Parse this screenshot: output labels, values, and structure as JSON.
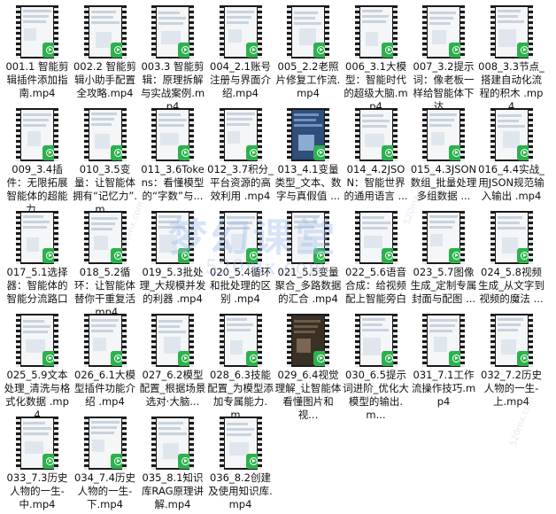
{
  "files": [
    {
      "name": "001.1 智能剪辑插件添加指南.mp4",
      "thumb": "light"
    },
    {
      "name": "002.2 智能剪辑小助手配置全攻略.mp4",
      "thumb": "light"
    },
    {
      "name": "003.3 智能剪辑：原理拆解与实战案例.mp4",
      "thumb": "light"
    },
    {
      "name": "004_2.1账号注册与界面介绍.mp4",
      "thumb": "light"
    },
    {
      "name": "005_2.2老照片修复工作流.mp4",
      "thumb": "light"
    },
    {
      "name": "006_3.1大模型：智能时代的超级大脑.mp4",
      "thumb": "light"
    },
    {
      "name": "007_3.2提示词：像老板一样给智能体下达...",
      "thumb": "light"
    },
    {
      "name": "008_3.3节点_搭建自动化流程的积木 .mp4",
      "thumb": "light"
    },
    {
      "name": "009_3.4插件：无限拓展智能体的超能力 ...",
      "thumb": "light"
    },
    {
      "name": "010_3.5变量：让智能体拥有“记忆力”.m...",
      "thumb": "light"
    },
    {
      "name": "011_3.6Tokens：看懂模型的“字数”与...",
      "thumb": "light"
    },
    {
      "name": "012_3.7积分_平台资源的高效利用 .mp4",
      "thumb": "light"
    },
    {
      "name": "013_4.1变量类型_文本、数字与真假值 ...",
      "thumb": "blue"
    },
    {
      "name": "014_4.2JSON：智能世界的通用语言 ...",
      "thumb": "light"
    },
    {
      "name": "015_4.3JSON数组_批量处理多组数据 ...",
      "thumb": "light"
    },
    {
      "name": "016_4.4实战_用JSON规范输入输出 .mp4",
      "thumb": "light"
    },
    {
      "name": "017_5.1选择器：智能体的智能分流路口 ...",
      "thumb": "light"
    },
    {
      "name": "018_5.2循环：让智能体替你干重复活 .mp4",
      "thumb": "light"
    },
    {
      "name": "019_5.3批处理_大规模并发的利器 .mp4",
      "thumb": "light"
    },
    {
      "name": "020_5.4循环和批处理的区别 .mp4",
      "thumb": "light"
    },
    {
      "name": "021_5.5变量聚合_多路数据的汇合 .mp4",
      "thumb": "light"
    },
    {
      "name": "022_5.6语音合成：给视频配上智能旁白 ...",
      "thumb": "light"
    },
    {
      "name": "023_5.7图像生成_定制专属封面与配图 ...",
      "thumb": "light"
    },
    {
      "name": "024_5.8视频生成_从文字到视频的魔法 ...",
      "thumb": "light"
    },
    {
      "name": "025_5.9文本处理_清洗与格式化数据 .mp4",
      "thumb": "light"
    },
    {
      "name": "026_6.1大模型插件功能介绍 .mp4",
      "thumb": "light"
    },
    {
      "name": "027_6.2模型配置_根据场景选对·大脑...",
      "thumb": "light"
    },
    {
      "name": "028_6.3技能配置_为模型添加专属能力.m...",
      "thumb": "light"
    },
    {
      "name": "029_6.4视觉理解_让智能体看懂图片和视...",
      "thumb": "dark"
    },
    {
      "name": "030_6.5提示词进阶_优化大模型的输出.m...",
      "thumb": "light"
    },
    {
      "name": "031_7.1工作流操作技巧.mp4",
      "thumb": "light"
    },
    {
      "name": "032_7.2历史人物的一生-上.mp4",
      "thumb": "light"
    },
    {
      "name": "033_7.3历史人物的一生-中.mp4",
      "thumb": "light"
    },
    {
      "name": "034_7.4历史人物的一生-下.mp4",
      "thumb": "light"
    },
    {
      "name": "035_8.1知识库RAG原理讲解.mp4",
      "thumb": "light"
    },
    {
      "name": "036_8.2创建及使用知识库.mp4",
      "thumb": "light"
    }
  ],
  "watermark": {
    "main": "梦幻课堂",
    "sub": "520mx.com",
    "small": "520mx.com"
  }
}
